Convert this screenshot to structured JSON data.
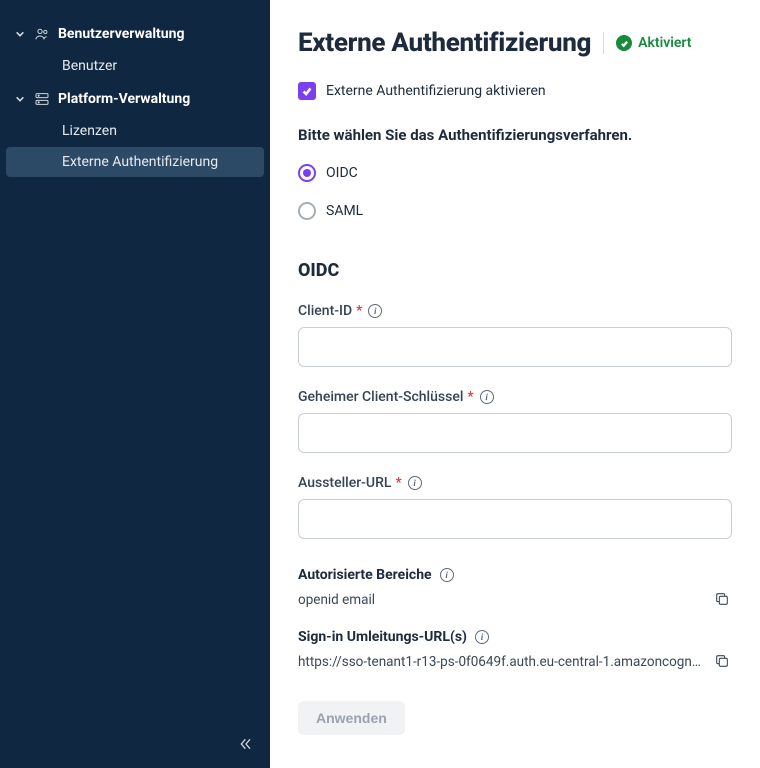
{
  "sidebar": {
    "groups": [
      {
        "title": "Benutzerverwaltung",
        "items": [
          {
            "label": "Benutzer",
            "active": false
          }
        ]
      },
      {
        "title": "Platform-Verwaltung",
        "items": [
          {
            "label": "Lizenzen",
            "active": false
          },
          {
            "label": "Externe Authentifizierung",
            "active": true
          }
        ]
      }
    ]
  },
  "header": {
    "title": "Externe Authentifizierung",
    "status_label": "Aktiviert"
  },
  "enable": {
    "label": "Externe Authentifizierung aktivieren",
    "checked": true
  },
  "method": {
    "prompt": "Bitte wählen Sie das Authentifizierungsverfahren.",
    "options": [
      {
        "label": "OIDC",
        "selected": true
      },
      {
        "label": "SAML",
        "selected": false
      }
    ]
  },
  "oidc": {
    "section_title": "OIDC",
    "fields": {
      "client_id": {
        "label": "Client-ID",
        "required": true,
        "value": ""
      },
      "client_secret": {
        "label": "Geheimer Client-Schlüssel",
        "required": true,
        "value": ""
      },
      "issuer_url": {
        "label": "Aussteller-URL",
        "required": true,
        "value": ""
      }
    },
    "readonly": {
      "scopes": {
        "label": "Autorisierte Bereiche",
        "value": "openid email"
      },
      "redirect": {
        "label": "Sign-in Umleitungs-URL(s)",
        "value": "https://sso-tenant1-r13-ps-0f0649f.auth.eu-central-1.amazoncogn…"
      }
    }
  },
  "actions": {
    "apply_label": "Anwenden"
  }
}
